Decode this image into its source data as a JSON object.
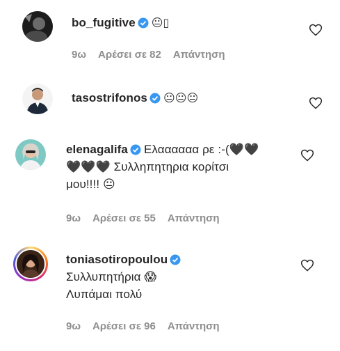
{
  "comments": [
    {
      "username": "bo_fugitive",
      "text": "😐▯",
      "time": "9ω",
      "likes": "Αρέσει σε 82",
      "reply": "Απάντηση"
    },
    {
      "username": "tasostrifonos",
      "text": "😐😐😐",
      "time": "",
      "likes": "",
      "reply": ""
    },
    {
      "username": "elenagalifa",
      "text_line1": "Ελαααααα ρε :-(🖤🖤",
      "text_line2": "🖤🖤🖤 Συλληπητηρια κορίτσι",
      "text_line3": "μου!!!! 😐",
      "time": "9ω",
      "likes": "Αρέσει σε 55",
      "reply": "Απάντηση"
    },
    {
      "username": "toniasotiropoulou",
      "text_line1": "Συλλυπητήρια 😱",
      "text_line2": "Λυπάμαι πολύ",
      "time": "9ω",
      "likes": "Αρέσει σε 96",
      "reply": "Απάντηση"
    }
  ],
  "colors": {
    "verified": "#3897f0",
    "meta": "#8e8e8e",
    "text": "#262626"
  },
  "icons": {
    "verified": "verified-badge-icon",
    "like": "heart-outline-icon"
  }
}
